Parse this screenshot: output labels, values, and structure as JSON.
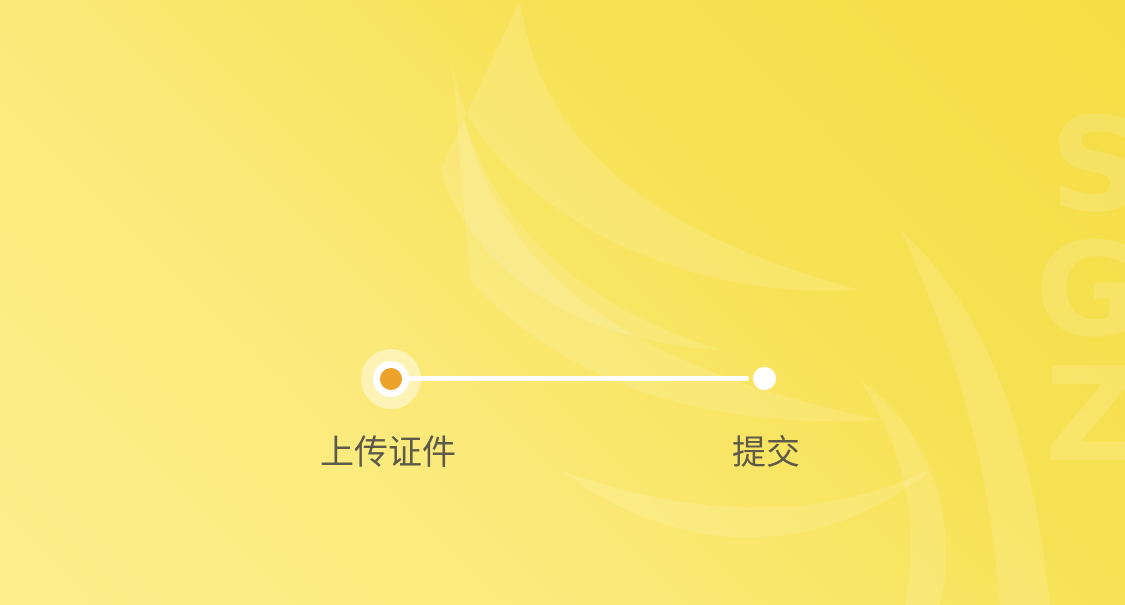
{
  "steps": [
    {
      "label": "上传证件",
      "state": "active"
    },
    {
      "label": "提交",
      "state": "pending"
    }
  ],
  "colors": {
    "active_dot": "#eda22b",
    "line": "#ffffff",
    "label_text": "#5e5a4a",
    "background_start": "#f5dd44",
    "background_end": "#fdf08c"
  }
}
